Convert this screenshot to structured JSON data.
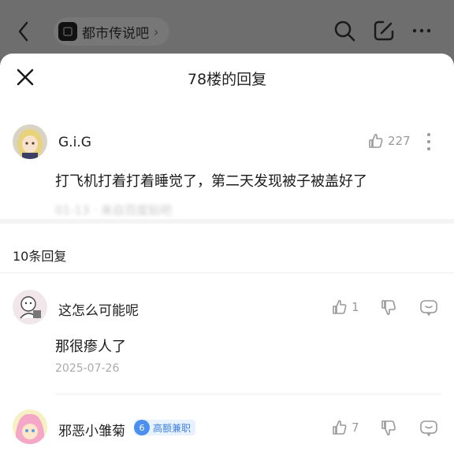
{
  "topbar": {
    "forum_name": "都市传说吧",
    "forum_arrow": "›"
  },
  "sheet": {
    "title": "78楼的回复"
  },
  "main_post": {
    "username": "G.i.G",
    "likes": "227",
    "text": "打飞机打着打着睡觉了，第二天发现被子被盖好了",
    "blurred_meta": "01-13 · 来自百度贴吧"
  },
  "replies_header": "10条回复",
  "replies": [
    {
      "username": "这怎么可能呢",
      "likes": "1",
      "text": "那很瘆人了",
      "date": "2025-07-26"
    },
    {
      "username": "邪恶小雏菊",
      "likes": "7",
      "badge_level": "6",
      "badge_text": "高额兼职"
    }
  ],
  "icons": {
    "back": "chevron-left-icon",
    "search": "search-icon",
    "edit": "edit-icon",
    "more": "more-icon",
    "close": "close-icon",
    "like": "thumbs-up-icon",
    "comment": "comment-icon"
  }
}
